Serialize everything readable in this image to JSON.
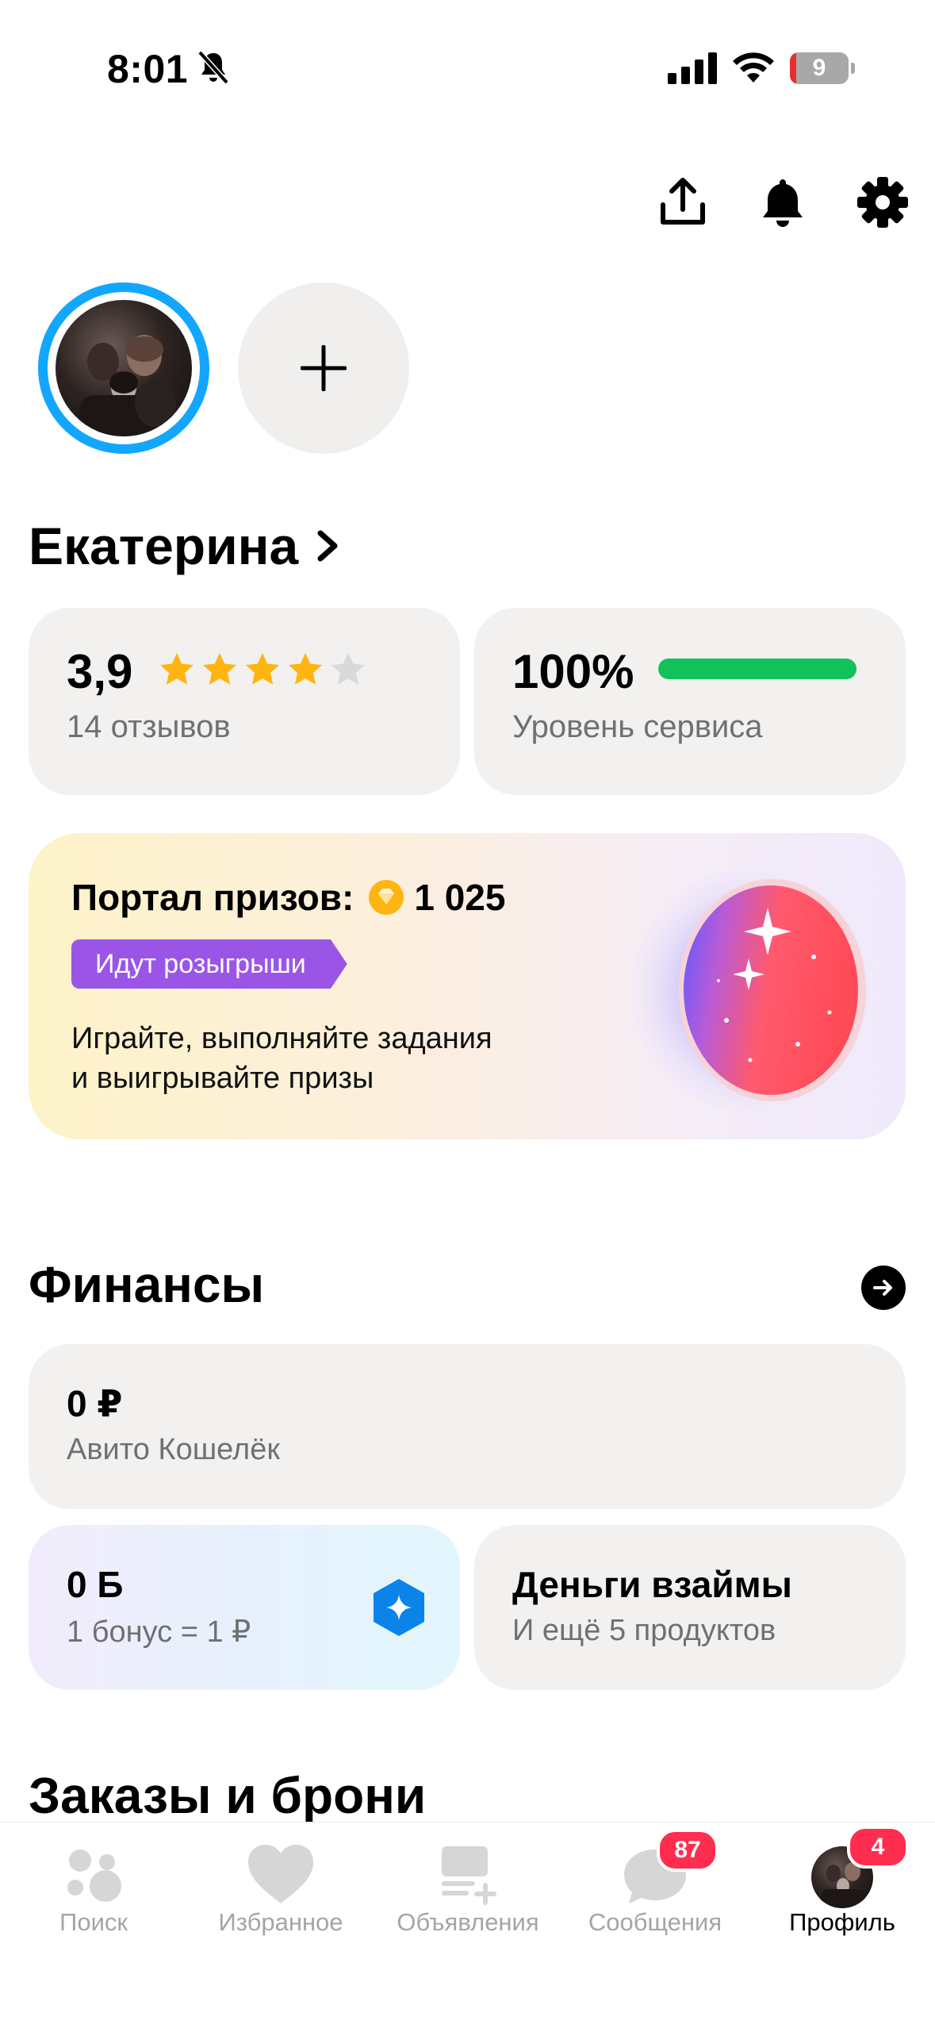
{
  "status_bar": {
    "time": "8:01",
    "battery": "9"
  },
  "profile": {
    "name": "Екатерина"
  },
  "rating": {
    "value": "3,9",
    "stars_filled": 4,
    "stars_total": 5,
    "reviews": "14 отзывов"
  },
  "service": {
    "value": "100%",
    "label": "Уровень сервиса",
    "level": 1.0
  },
  "portal": {
    "title": "Портал призов:",
    "points": "1 025",
    "badge": "Идут розыгрыши",
    "desc_line1": "Играйте, выполняйте задания",
    "desc_line2": "и выигрывайте призы"
  },
  "finance": {
    "title": "Финансы",
    "wallet": {
      "amount": "0 ₽",
      "label": "Авито Кошелёк"
    },
    "bonus": {
      "amount": "0 Б",
      "label": "1 бонус = 1 ₽"
    },
    "loan": {
      "title": "Деньги взаймы",
      "label": "И ещё 5 продуктов"
    }
  },
  "orders": {
    "title": "Заказы и брони"
  },
  "tabs": [
    {
      "label": "Поиск",
      "icon": "search-dots-icon"
    },
    {
      "label": "Избранное",
      "icon": "heart-icon"
    },
    {
      "label": "Объявления",
      "icon": "ads-icon"
    },
    {
      "label": "Сообщения",
      "icon": "chat-icon",
      "badge": "87"
    },
    {
      "label": "Профиль",
      "icon": "avatar",
      "badge": "4",
      "active": true
    }
  ],
  "colors": {
    "accent_blue": "#12a6ff",
    "service_green": "#12c15a",
    "star_gold": "#ffb511",
    "badge_purple": "#9a55e6",
    "notification_red": "#ff2d4f"
  }
}
